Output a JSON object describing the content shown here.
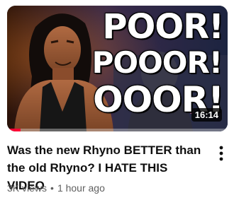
{
  "video": {
    "thumbnail": {
      "overlay_lines": [
        "POOR!",
        "POOOR!",
        "OOOR!"
      ],
      "duration": "16:14",
      "watch_progress_percent": 6
    },
    "title": "Was the new Rhyno BETTER than the old Rhyno? I HATE THIS VIDEO",
    "views": "3K views",
    "separator": "•",
    "age": "1 hour ago",
    "menu_icon": "more-vert-icon"
  },
  "colors": {
    "progress": "#ff0033",
    "title_text": "#0f0f0f",
    "meta_text": "#606060"
  }
}
